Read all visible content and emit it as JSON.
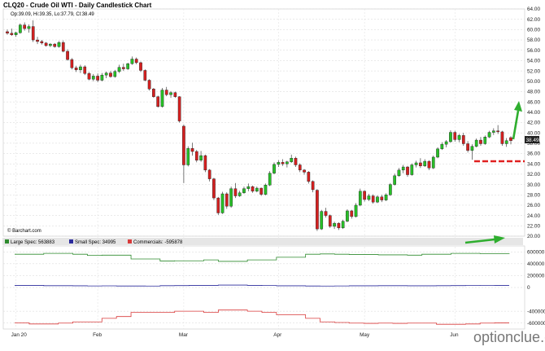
{
  "chart_data": [
    {
      "type": "candlestick",
      "title": "CLQ20 - Crude Oil WTI - Daily Candlestick Chart",
      "ohlc_readout": "Op:39.09, Hi:39.35, Lo:37.79, Cl:38.49",
      "source": "© Barchart.com",
      "last_price_label": "38.49",
      "ylim": [
        20,
        64
      ],
      "y_ticks": [
        "64.00",
        "62.00",
        "60.00",
        "58.00",
        "56.00",
        "54.00",
        "52.00",
        "50.00",
        "48.00",
        "46.00",
        "44.00",
        "42.00",
        "40.00",
        "38.00",
        "36.00",
        "34.00",
        "32.00",
        "30.00",
        "28.00",
        "26.00",
        "24.00",
        "22.00",
        "20.00"
      ],
      "candles": [
        {
          "o": 59.6,
          "h": 60.0,
          "l": 59.0,
          "c": 59.3
        },
        {
          "o": 59.3,
          "h": 60.2,
          "l": 58.8,
          "c": 59.0
        },
        {
          "o": 59.0,
          "h": 59.6,
          "l": 58.6,
          "c": 59.4
        },
        {
          "o": 59.4,
          "h": 61.2,
          "l": 59.2,
          "c": 60.9
        },
        {
          "o": 60.9,
          "h": 61.4,
          "l": 59.8,
          "c": 60.2
        },
        {
          "o": 60.2,
          "h": 61.0,
          "l": 59.4,
          "c": 60.6
        },
        {
          "o": 60.6,
          "h": 61.8,
          "l": 57.6,
          "c": 58.0
        },
        {
          "o": 58.0,
          "h": 58.6,
          "l": 57.2,
          "c": 57.7
        },
        {
          "o": 57.7,
          "h": 58.0,
          "l": 57.1,
          "c": 57.4
        },
        {
          "o": 57.4,
          "h": 57.6,
          "l": 56.7,
          "c": 56.9
        },
        {
          "o": 56.9,
          "h": 57.4,
          "l": 56.6,
          "c": 57.2
        },
        {
          "o": 57.2,
          "h": 57.4,
          "l": 56.5,
          "c": 56.7
        },
        {
          "o": 56.7,
          "h": 57.8,
          "l": 56.5,
          "c": 57.5
        },
        {
          "o": 57.5,
          "h": 57.9,
          "l": 55.6,
          "c": 55.8
        },
        {
          "o": 55.8,
          "h": 56.2,
          "l": 54.0,
          "c": 54.2
        },
        {
          "o": 54.2,
          "h": 54.5,
          "l": 52.3,
          "c": 52.6
        },
        {
          "o": 52.6,
          "h": 53.0,
          "l": 51.8,
          "c": 52.2
        },
        {
          "o": 52.2,
          "h": 53.2,
          "l": 51.6,
          "c": 52.8
        },
        {
          "o": 52.8,
          "h": 53.1,
          "l": 51.2,
          "c": 51.5
        },
        {
          "o": 51.5,
          "h": 51.8,
          "l": 50.2,
          "c": 50.4
        },
        {
          "o": 50.4,
          "h": 51.4,
          "l": 50.0,
          "c": 51.0
        },
        {
          "o": 51.0,
          "h": 51.5,
          "l": 49.8,
          "c": 50.2
        },
        {
          "o": 50.2,
          "h": 51.6,
          "l": 50.0,
          "c": 51.2
        },
        {
          "o": 51.2,
          "h": 51.9,
          "l": 50.6,
          "c": 51.6
        },
        {
          "o": 51.6,
          "h": 52.0,
          "l": 50.7,
          "c": 50.9
        },
        {
          "o": 50.9,
          "h": 52.2,
          "l": 50.7,
          "c": 51.9
        },
        {
          "o": 51.9,
          "h": 53.2,
          "l": 51.6,
          "c": 52.7
        },
        {
          "o": 52.7,
          "h": 53.4,
          "l": 52.0,
          "c": 52.4
        },
        {
          "o": 52.4,
          "h": 53.6,
          "l": 52.2,
          "c": 53.4
        },
        {
          "o": 53.4,
          "h": 54.8,
          "l": 53.2,
          "c": 54.3
        },
        {
          "o": 54.3,
          "h": 54.6,
          "l": 53.3,
          "c": 53.6
        },
        {
          "o": 53.6,
          "h": 53.8,
          "l": 51.8,
          "c": 52.1
        },
        {
          "o": 52.1,
          "h": 52.3,
          "l": 50.0,
          "c": 50.2
        },
        {
          "o": 50.2,
          "h": 50.4,
          "l": 48.2,
          "c": 48.5
        },
        {
          "o": 48.5,
          "h": 48.7,
          "l": 46.8,
          "c": 47.0
        },
        {
          "o": 47.0,
          "h": 47.2,
          "l": 44.9,
          "c": 45.1
        },
        {
          "o": 45.1,
          "h": 48.7,
          "l": 44.9,
          "c": 48.3
        },
        {
          "o": 48.3,
          "h": 48.9,
          "l": 47.1,
          "c": 47.4
        },
        {
          "o": 47.4,
          "h": 48.1,
          "l": 46.8,
          "c": 47.8
        },
        {
          "o": 47.8,
          "h": 48.0,
          "l": 46.8,
          "c": 47.0
        },
        {
          "o": 47.0,
          "h": 47.1,
          "l": 42.0,
          "c": 42.3
        },
        {
          "o": 41.3,
          "h": 41.6,
          "l": 30.3,
          "c": 33.8
        },
        {
          "o": 33.8,
          "h": 37.4,
          "l": 33.5,
          "c": 37.0
        },
        {
          "o": 37.0,
          "h": 38.1,
          "l": 35.6,
          "c": 36.4
        },
        {
          "o": 36.4,
          "h": 36.7,
          "l": 34.3,
          "c": 34.7
        },
        {
          "o": 34.7,
          "h": 36.5,
          "l": 34.4,
          "c": 35.6
        },
        {
          "o": 35.6,
          "h": 35.8,
          "l": 32.4,
          "c": 32.8
        },
        {
          "o": 32.8,
          "h": 33.0,
          "l": 30.6,
          "c": 31.1
        },
        {
          "o": 31.1,
          "h": 31.3,
          "l": 27.0,
          "c": 27.4
        },
        {
          "o": 27.4,
          "h": 27.6,
          "l": 24.1,
          "c": 24.5
        },
        {
          "o": 24.5,
          "h": 28.6,
          "l": 24.3,
          "c": 28.2
        },
        {
          "o": 28.2,
          "h": 28.5,
          "l": 25.3,
          "c": 25.8
        },
        {
          "o": 25.8,
          "h": 29.6,
          "l": 25.5,
          "c": 29.2
        },
        {
          "o": 29.2,
          "h": 30.3,
          "l": 27.4,
          "c": 27.8
        },
        {
          "o": 27.8,
          "h": 28.8,
          "l": 27.6,
          "c": 28.4
        },
        {
          "o": 28.4,
          "h": 29.6,
          "l": 28.2,
          "c": 29.2
        },
        {
          "o": 29.2,
          "h": 30.2,
          "l": 28.7,
          "c": 29.6
        },
        {
          "o": 29.6,
          "h": 29.8,
          "l": 28.4,
          "c": 28.7
        },
        {
          "o": 28.7,
          "h": 29.6,
          "l": 28.5,
          "c": 29.3
        },
        {
          "o": 29.3,
          "h": 29.4,
          "l": 27.8,
          "c": 28.1
        },
        {
          "o": 28.1,
          "h": 30.2,
          "l": 27.9,
          "c": 29.9
        },
        {
          "o": 29.9,
          "h": 32.6,
          "l": 29.7,
          "c": 32.2
        },
        {
          "o": 32.2,
          "h": 34.3,
          "l": 32.0,
          "c": 33.9
        },
        {
          "o": 33.9,
          "h": 34.7,
          "l": 33.4,
          "c": 34.3
        },
        {
          "o": 34.3,
          "h": 34.9,
          "l": 33.6,
          "c": 34.0
        },
        {
          "o": 34.0,
          "h": 34.6,
          "l": 33.3,
          "c": 34.4
        },
        {
          "o": 34.4,
          "h": 35.8,
          "l": 34.2,
          "c": 35.1
        },
        {
          "o": 35.1,
          "h": 35.4,
          "l": 33.4,
          "c": 33.8
        },
        {
          "o": 33.8,
          "h": 34.1,
          "l": 32.4,
          "c": 32.8
        },
        {
          "o": 32.8,
          "h": 33.0,
          "l": 31.9,
          "c": 32.4
        },
        {
          "o": 32.4,
          "h": 32.6,
          "l": 30.2,
          "c": 30.6
        },
        {
          "o": 30.6,
          "h": 30.8,
          "l": 28.5,
          "c": 29.0
        },
        {
          "o": 28.9,
          "h": 29.1,
          "l": 21.0,
          "c": 21.4
        },
        {
          "o": 21.4,
          "h": 25.1,
          "l": 21.2,
          "c": 24.8
        },
        {
          "o": 24.8,
          "h": 25.5,
          "l": 23.6,
          "c": 24.0
        },
        {
          "o": 24.0,
          "h": 24.2,
          "l": 21.6,
          "c": 21.9
        },
        {
          "o": 21.9,
          "h": 22.8,
          "l": 21.4,
          "c": 22.5
        },
        {
          "o": 22.5,
          "h": 22.7,
          "l": 21.2,
          "c": 21.6
        },
        {
          "o": 21.6,
          "h": 23.2,
          "l": 21.4,
          "c": 22.9
        },
        {
          "o": 22.9,
          "h": 25.2,
          "l": 22.7,
          "c": 24.9
        },
        {
          "o": 24.9,
          "h": 25.1,
          "l": 23.4,
          "c": 23.8
        },
        {
          "o": 23.8,
          "h": 26.4,
          "l": 23.6,
          "c": 26.0
        },
        {
          "o": 26.0,
          "h": 29.2,
          "l": 25.8,
          "c": 28.7
        },
        {
          "o": 28.7,
          "h": 28.9,
          "l": 26.7,
          "c": 27.1
        },
        {
          "o": 27.1,
          "h": 28.2,
          "l": 26.8,
          "c": 27.8
        },
        {
          "o": 27.8,
          "h": 28.1,
          "l": 26.3,
          "c": 26.6
        },
        {
          "o": 26.6,
          "h": 27.9,
          "l": 26.4,
          "c": 27.6
        },
        {
          "o": 27.6,
          "h": 28.0,
          "l": 26.6,
          "c": 27.0
        },
        {
          "o": 27.0,
          "h": 28.3,
          "l": 26.8,
          "c": 28.0
        },
        {
          "o": 28.0,
          "h": 30.3,
          "l": 27.8,
          "c": 30.0
        },
        {
          "o": 30.0,
          "h": 32.1,
          "l": 29.8,
          "c": 31.7
        },
        {
          "o": 31.7,
          "h": 33.2,
          "l": 31.5,
          "c": 32.8
        },
        {
          "o": 32.8,
          "h": 33.8,
          "l": 32.2,
          "c": 33.4
        },
        {
          "o": 33.4,
          "h": 33.6,
          "l": 31.5,
          "c": 31.9
        },
        {
          "o": 31.9,
          "h": 34.1,
          "l": 31.7,
          "c": 33.8
        },
        {
          "o": 33.8,
          "h": 34.6,
          "l": 33.3,
          "c": 34.2
        },
        {
          "o": 34.2,
          "h": 35.1,
          "l": 33.2,
          "c": 33.6
        },
        {
          "o": 33.6,
          "h": 34.9,
          "l": 33.4,
          "c": 34.5
        },
        {
          "o": 34.5,
          "h": 34.7,
          "l": 32.8,
          "c": 33.2
        },
        {
          "o": 33.2,
          "h": 35.6,
          "l": 33.0,
          "c": 35.3
        },
        {
          "o": 35.3,
          "h": 37.2,
          "l": 35.1,
          "c": 36.9
        },
        {
          "o": 36.9,
          "h": 38.2,
          "l": 36.7,
          "c": 37.8
        },
        {
          "o": 37.8,
          "h": 38.6,
          "l": 37.2,
          "c": 38.3
        },
        {
          "o": 38.3,
          "h": 40.5,
          "l": 38.1,
          "c": 40.1
        },
        {
          "o": 40.1,
          "h": 40.4,
          "l": 38.3,
          "c": 38.7
        },
        {
          "o": 38.7,
          "h": 39.8,
          "l": 38.2,
          "c": 39.5
        },
        {
          "o": 39.5,
          "h": 40.0,
          "l": 37.5,
          "c": 37.9
        },
        {
          "o": 37.9,
          "h": 38.4,
          "l": 36.2,
          "c": 36.6
        },
        {
          "o": 36.6,
          "h": 37.8,
          "l": 34.8,
          "c": 37.4
        },
        {
          "o": 37.4,
          "h": 38.9,
          "l": 37.2,
          "c": 38.6
        },
        {
          "o": 38.6,
          "h": 39.2,
          "l": 37.5,
          "c": 37.9
        },
        {
          "o": 37.9,
          "h": 39.5,
          "l": 37.7,
          "c": 39.2
        },
        {
          "o": 39.2,
          "h": 40.4,
          "l": 39.0,
          "c": 40.1
        },
        {
          "o": 40.1,
          "h": 40.9,
          "l": 39.6,
          "c": 40.4
        },
        {
          "o": 40.4,
          "h": 41.5,
          "l": 39.8,
          "c": 40.2
        },
        {
          "o": 40.2,
          "h": 40.4,
          "l": 37.5,
          "c": 37.9
        },
        {
          "o": 37.9,
          "h": 39.0,
          "l": 37.3,
          "c": 38.5
        },
        {
          "o": 39.09,
          "h": 39.35,
          "l": 37.79,
          "c": 38.49
        }
      ],
      "support_level": 34.7,
      "months": [
        "Jan 20",
        "Feb",
        "Mar",
        "Apr",
        "May",
        "Jun"
      ],
      "cot": {
        "legend": [
          {
            "name": "Large Spec: 563883",
            "color": "#2e8b2e"
          },
          {
            "name": "Small Spec: 34995",
            "color": "#2b2b9c"
          },
          {
            "name": "Commercials: -595878",
            "color": "#d83a3a"
          }
        ],
        "ylim": [
          -700000,
          700000
        ],
        "y_ticks": [
          {
            "value": 600000,
            "label": "600000"
          },
          {
            "value": 400000,
            "label": "400000"
          },
          {
            "value": 200000,
            "label": "200000"
          },
          {
            "value": 0,
            "label": "0"
          },
          {
            "value": -400000,
            "label": "-400000"
          },
          {
            "value": -600000,
            "label": "-600000"
          }
        ],
        "large_spec": [
          560000,
          560000,
          575000,
          575000,
          560000,
          540000,
          545000,
          545000,
          480000,
          480000,
          445000,
          450000,
          450000,
          465000,
          440000,
          440000,
          465000,
          465000,
          510000,
          510000,
          560000,
          565000,
          560000,
          555000,
          555000,
          550000,
          550000,
          545000,
          560000,
          560000,
          575000,
          575000,
          570000,
          570000,
          563883
        ],
        "small_spec": [
          35000,
          35000,
          30000,
          30000,
          28000,
          26000,
          27000,
          25000,
          25000,
          24000,
          30000,
          32000,
          35000,
          35000,
          40000,
          40000,
          35000,
          33000,
          28000,
          28000,
          25000,
          24000,
          26000,
          28000,
          28000,
          30000,
          30000,
          28000,
          28000,
          30000,
          32000,
          34000,
          36000,
          34995,
          34995
        ],
        "commercials": [
          -595000,
          -615000,
          -615000,
          -600000,
          -580000,
          -580000,
          -520000,
          -490000,
          -420000,
          -420000,
          -420000,
          -400000,
          -400000,
          -420000,
          -380000,
          -380000,
          -400000,
          -420000,
          -460000,
          -460000,
          -520000,
          -580000,
          -590000,
          -600000,
          -605000,
          -600000,
          -605000,
          -600000,
          -600000,
          -620000,
          -620000,
          -615000,
          -600000,
          -595878,
          -595878
        ]
      }
    }
  ],
  "watermark": "optionclue.com"
}
